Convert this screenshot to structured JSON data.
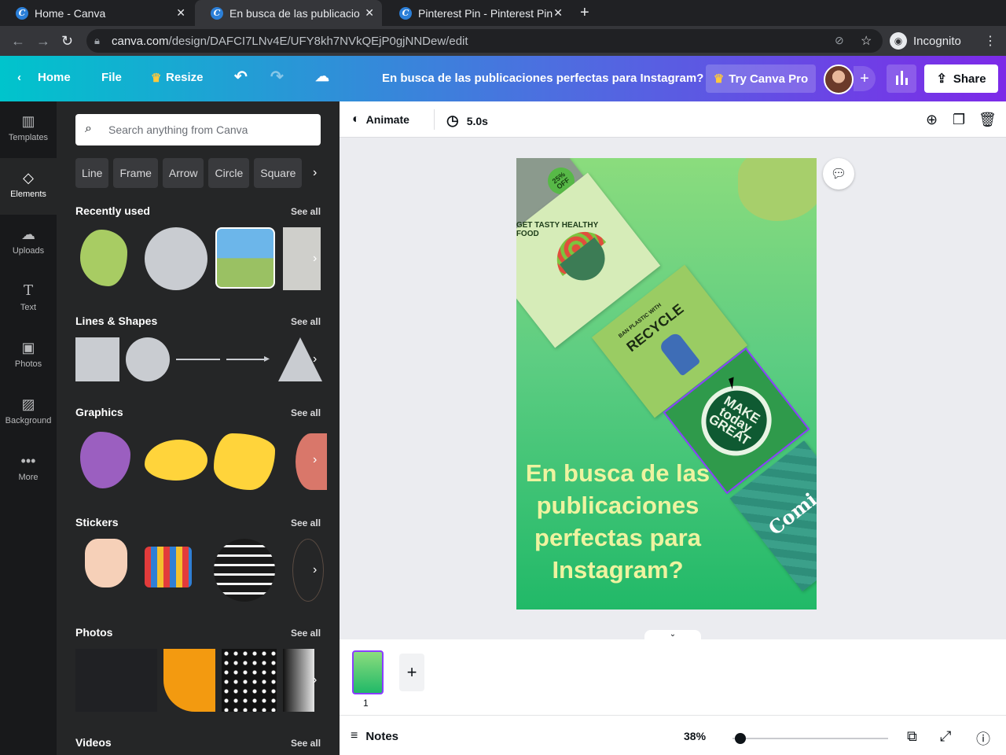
{
  "browser": {
    "tabs": [
      {
        "title": "Home - Canva"
      },
      {
        "title": "En busca de las publicacio"
      },
      {
        "title": "Pinterest Pin - Pinterest Pin"
      }
    ],
    "url_host": "canva.com",
    "url_path": "/design/DAFCI7LNv4E/UFY8kh7NVkQEjP0gjNNDew/edit",
    "incognito_label": "Incognito"
  },
  "topbar": {
    "home_label": "Home",
    "file_label": "File",
    "resize_label": "Resize",
    "design_title": "En busca de las publicaciones perfectas para Instagram?",
    "try_pro_label": "Try Canva Pro",
    "share_label": "Share"
  },
  "rail": {
    "items": [
      {
        "label": "Templates",
        "icon": "templates-icon"
      },
      {
        "label": "Elements",
        "icon": "elements-icon"
      },
      {
        "label": "Uploads",
        "icon": "uploads-icon"
      },
      {
        "label": "Text",
        "icon": "text-icon"
      },
      {
        "label": "Photos",
        "icon": "photos-icon"
      },
      {
        "label": "Background",
        "icon": "background-icon"
      },
      {
        "label": "More",
        "icon": "more-icon"
      }
    ]
  },
  "panel": {
    "search_placeholder": "Search anything from Canva",
    "chips": [
      "Line",
      "Frame",
      "Arrow",
      "Circle",
      "Square"
    ],
    "see_all": "See all",
    "sections": {
      "recently_used": "Recently used",
      "lines_shapes": "Lines & Shapes",
      "graphics": "Graphics",
      "stickers": "Stickers",
      "photos": "Photos",
      "videos": "Videos"
    }
  },
  "editor": {
    "animate_label": "Animate",
    "duration_label": "5.0s",
    "canvas": {
      "headline": "En busca de las publicaciones perfectas para Instagram?",
      "badge_text": "25% OFF",
      "card1_text": "GET TASTY HEALTHY FOOD",
      "card2_small": "BAN PLASTIC WITH",
      "card2_text": "RECYCLE",
      "card3_text": "MAKE today GREAT",
      "card4_text": "Comi"
    },
    "page_number": "1",
    "notes_label": "Notes",
    "zoom_label": "38%"
  },
  "colors": {
    "topbar_start": "#00c4cc",
    "topbar_end": "#7d2ae8",
    "selection": "#8b3dff"
  }
}
